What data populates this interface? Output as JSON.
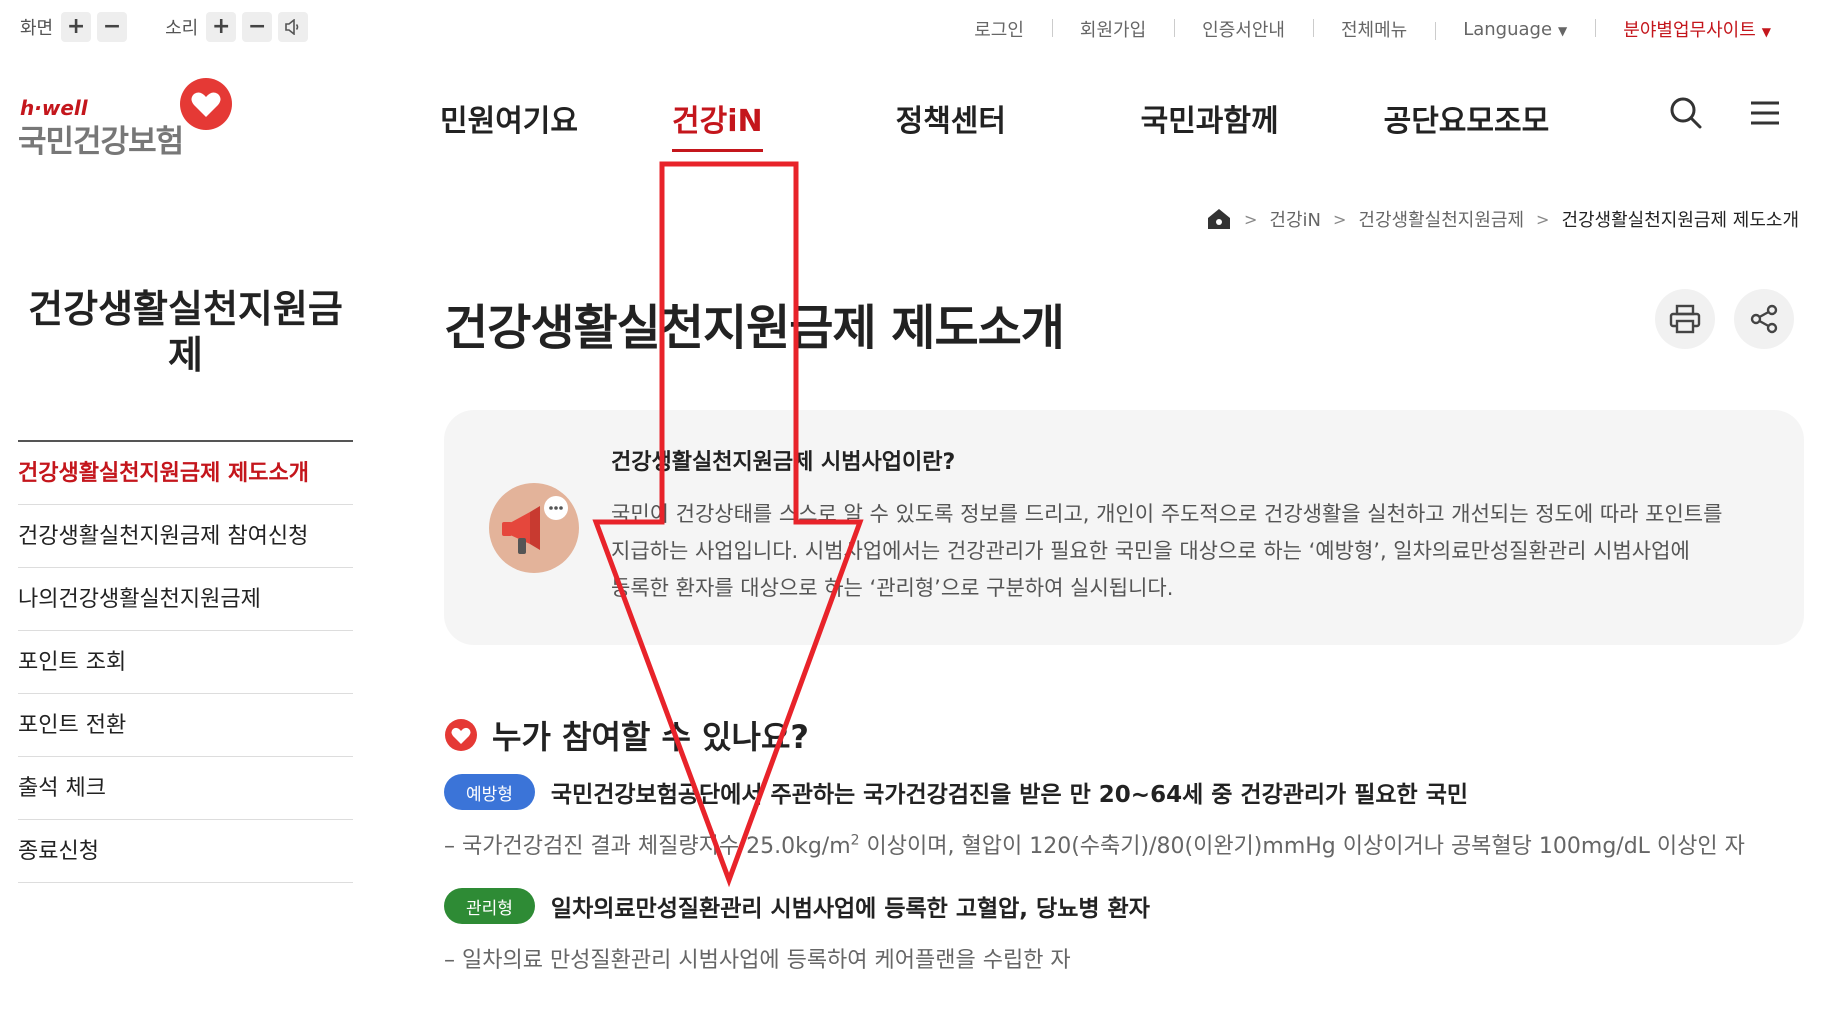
{
  "util": {
    "screen_label": "화면",
    "sound_label": "소리",
    "plus": "+",
    "minus": "−",
    "links": [
      "로그인",
      "회원가입",
      "인증서안내",
      "전체메뉴",
      "Language",
      "분야별업무사이트"
    ]
  },
  "logo": {
    "brand": "h·well",
    "name": "국민건강보험"
  },
  "gnb": [
    "민원여기요",
    "건강iN",
    "정책센터",
    "국민과함께",
    "공단요모조모"
  ],
  "breadcrumb": [
    "건강iN",
    "건강생활실천지원금제",
    "건강생활실천지원금제 제도소개"
  ],
  "sidebar": {
    "title_line1": "건강생활실천지원금",
    "title_line2": "제",
    "items": [
      "건강생활실천지원금제 제도소개",
      "건강생활실천지원금제 참여신청",
      "나의건강생활실천지원금제",
      "포인트 조회",
      "포인트 전환",
      "출석 체크",
      "종료신청"
    ]
  },
  "main": {
    "title": "건강생활실천지원금제 제도소개",
    "info_title": "건강생활실천지원금제 시범사업이란?",
    "info_line1": "국민이 건강상태를 스스로 알 수 있도록 정보를 드리고, 개인이 주도적으로 건강생활을 실천하고 개선되는 정도에 따라 포인트를",
    "info_line2": "지급하는 사업입니다. 시범사업에서는 건강관리가 필요한 국민을 대상으로 하는 ‘예방형’, 일차의료만성질환관리 시범사업에",
    "info_line3": "등록한 환자를 대상으로 하는 ‘관리형’으로 구분하여 실시됩니다.",
    "section_title": "누가 참여할 수 있나요?",
    "type1_badge": "예방형",
    "type1_text": "국민건강보험공단에서 주관하는 국가건강검진을 받은 만 20~64세 중 건강관리가 필요한 국민",
    "type1_sub_a": "– 국가건강검진 결과 체질량지수 25.0kg/m",
    "type1_sub_sup": "2",
    "type1_sub_b": " 이상이며, 혈압이 120(수축기)/80(이완기)mmHg 이상이거나 공복혈당 100mg/dL 이상인 자",
    "type2_badge": "관리형",
    "type2_text": "일차의료만성질환관리 시범사업에 등록한 고혈압, 당뇨병 환자",
    "type2_sub": "– 일차의료 만성질환관리 시범사업에 등록하여 케어플랜을 수립한 자"
  },
  "colors": {
    "accent": "#c4161c",
    "blue_badge": "#3b74d8",
    "green_badge": "#2e8b35",
    "info_bg": "#f5f5f5"
  }
}
